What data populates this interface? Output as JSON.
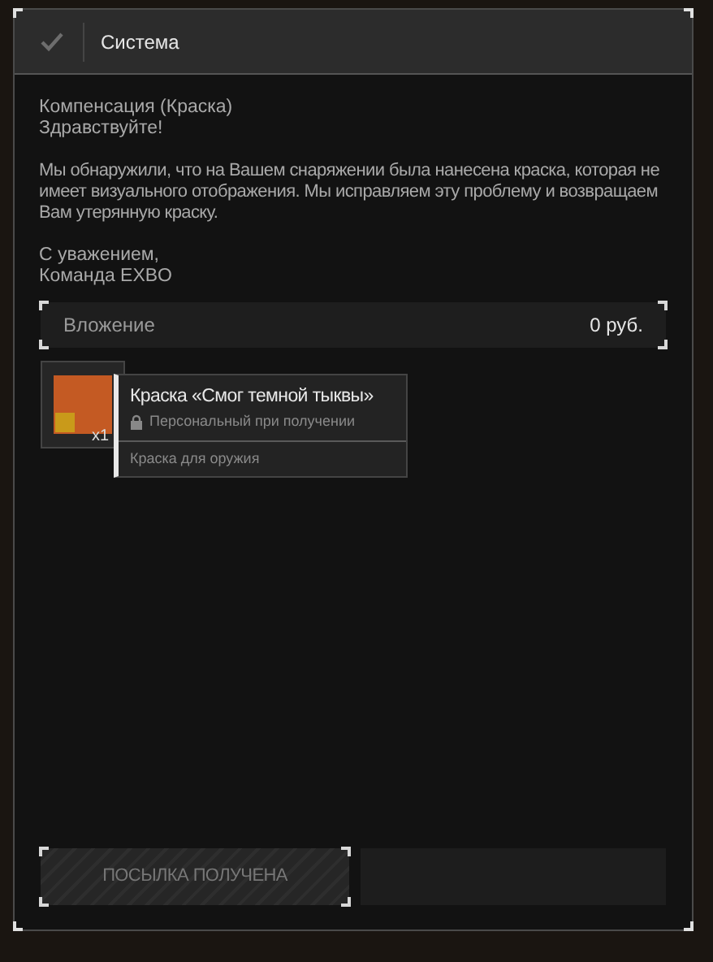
{
  "header": {
    "title": "Система",
    "read": true
  },
  "message": {
    "subject": "Компенсация (Краска)",
    "greeting": "Здравствуйте!",
    "body": "Мы обнаружили, что на Вашем снаряжении была нанесена краска, которая не имеет визуального отображения. Мы исправляем эту проблему и возвращаем Вам утерянную краску.",
    "signature": [
      "С уважением,",
      "Команда EXBO"
    ]
  },
  "attachment": {
    "label": "Вложение",
    "amount": "0 руб."
  },
  "item": {
    "count": "x1",
    "name": "Краска «Смог темной тыквы»",
    "binding": "Персональный при получении",
    "category": "Краска для оружия"
  },
  "claim_button": {
    "label": "ПОСЫЛКА ПОЛУЧЕНА",
    "disabled": true
  }
}
